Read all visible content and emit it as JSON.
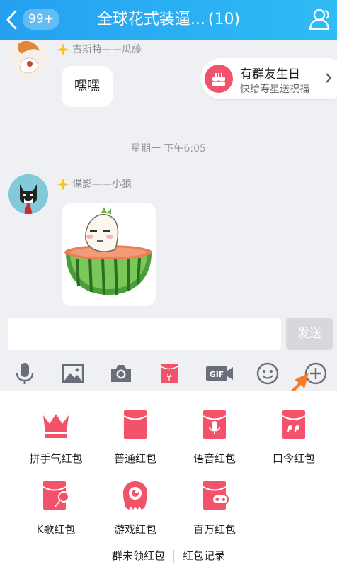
{
  "header": {
    "back_badge": "99+",
    "title": "全球花式装逼...",
    "member_count": "(10)"
  },
  "messages": [
    {
      "sender": "古斯特——瓜藤",
      "text": "嘿嘿"
    },
    {
      "sender": "谍影——小狼",
      "content": "sticker"
    }
  ],
  "time_separator": "星期一 下午6:05",
  "birthday_banner": {
    "title": "有群友生日",
    "subtitle": "快给寿星送祝福"
  },
  "input": {
    "value": "",
    "send_label": "发送"
  },
  "toolbar": [
    "mic-icon",
    "image-icon",
    "camera-icon",
    "red-packet-icon",
    "gif-icon",
    "emoji-icon",
    "plus-icon"
  ],
  "panel": {
    "items": [
      {
        "label": "拼手气红包",
        "icon": "crown-icon"
      },
      {
        "label": "普通红包",
        "icon": "envelope-icon"
      },
      {
        "label": "语音红包",
        "icon": "voice-envelope-icon"
      },
      {
        "label": "口令红包",
        "icon": "quote-envelope-icon"
      },
      {
        "label": "K歌红包",
        "icon": "karaoke-envelope-icon"
      },
      {
        "label": "游戏红包",
        "icon": "game-icon"
      },
      {
        "label": "百万红包",
        "icon": "million-envelope-icon"
      }
    ],
    "links": [
      "群未领红包",
      "红包记录"
    ]
  },
  "colors": {
    "header": "#25a0f0",
    "accent_red": "#f3536a",
    "chat_bg": "#eff0f4",
    "arrow": "#f57a2c"
  }
}
